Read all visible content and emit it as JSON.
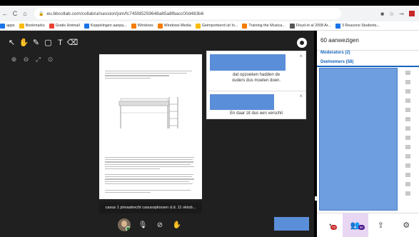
{
  "browser": {
    "url": "eu.bbcollab.com/collab/ui/session/join/fc745fd5259648a85a8fbacc00d483b6",
    "bookmarks": [
      "apps",
      "Bookmarks",
      "Gratis Hotmail",
      "Koppelingen aanpa...",
      "Windows",
      "Windows Media",
      "Geimporteerd uit In...",
      "Training the Musica...",
      "Floyd et al 2008 Ar...",
      "3 Reasons Students..."
    ],
    "bookmark_colors": [
      "#1a73e8",
      "#fbbc05",
      "#ea4335",
      "#1a73e8",
      "#f57c00",
      "#f57c00",
      "#fbbc05",
      "#f57c00",
      "#555555",
      "#1a73e8"
    ]
  },
  "stage": {
    "caption": "casus 1 privaatrecht casusoplossen d.d. 11 oktob...",
    "note_1": {
      "text_line1": "dat opzoeken hadden de",
      "text_line2": "ouders dus moeten doen."
    },
    "note_2": {
      "text": "En daar zit dus een verschil"
    }
  },
  "panel": {
    "title": "60 aanwezigen",
    "moderators": "Moderators (2)",
    "participants": "Deelnemers (58)",
    "tab_badges": [
      "72",
      "60"
    ]
  },
  "colors": {
    "accent": "#1565c0",
    "note_blue": "#5b8ed9",
    "badge_red": "#c62828"
  }
}
